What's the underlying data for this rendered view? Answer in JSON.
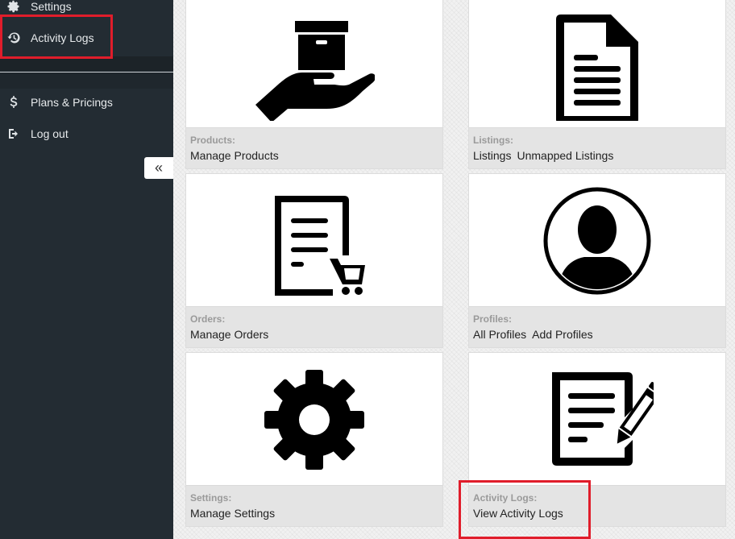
{
  "sidebar": {
    "items": [
      {
        "label": "Settings",
        "icon": "gear-icon"
      },
      {
        "label": "Activity Logs",
        "icon": "history-icon"
      },
      {
        "label": "Plans & Pricings",
        "icon": "dollar-icon"
      },
      {
        "label": "Log out",
        "icon": "logout-icon"
      }
    ],
    "collapse_glyph": "«"
  },
  "cards": [
    {
      "category": "Products:",
      "links": [
        "Manage Products"
      ],
      "icon": "hand-box-icon"
    },
    {
      "category": "Listings:",
      "links": [
        "Listings",
        "Unmapped Listings"
      ],
      "icon": "document-icon"
    },
    {
      "category": "Orders:",
      "links": [
        "Manage Orders"
      ],
      "icon": "order-cart-icon"
    },
    {
      "category": "Profiles:",
      "links": [
        "All Profiles",
        "Add Profiles"
      ],
      "icon": "profile-avatar-icon"
    },
    {
      "category": "Settings:",
      "links": [
        "Manage Settings"
      ],
      "icon": "gear-icon"
    },
    {
      "category": "Activity Logs:",
      "links": [
        "View Activity Logs"
      ],
      "icon": "edit-document-icon"
    }
  ],
  "colors": {
    "sidebar_bg": "#232c33",
    "highlight": "#e01d2b",
    "card_footer": "#e4e4e4"
  }
}
